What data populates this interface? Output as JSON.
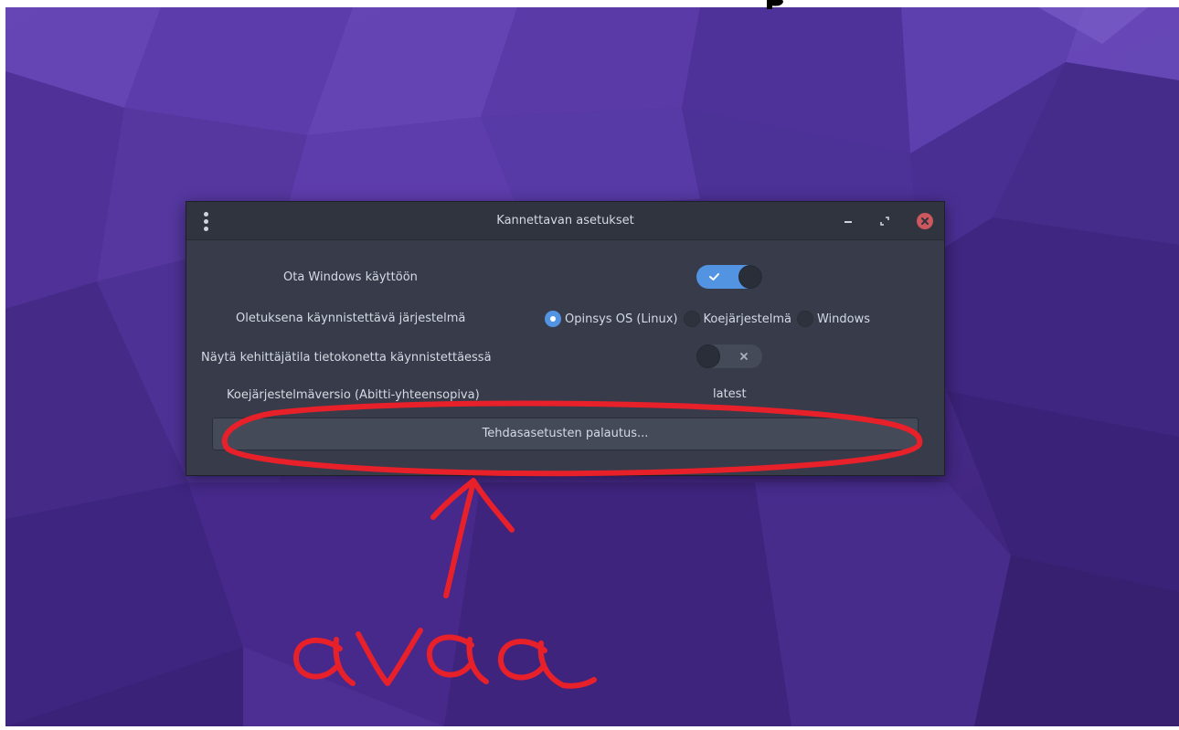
{
  "window": {
    "title": "Kannettavan asetukset"
  },
  "settings": {
    "enable_windows": {
      "label": "Ota Windows käyttöön",
      "state": "on"
    },
    "default_os": {
      "label": "Oletuksena käynnistettävä järjestelmä",
      "options": [
        {
          "label": "Opinsys OS (Linux)",
          "checked": true
        },
        {
          "label": "Koejärjestelmä",
          "checked": false
        },
        {
          "label": "Windows",
          "checked": false
        }
      ]
    },
    "developer_mode": {
      "label": "Näytä kehittäjätila tietokonetta käynnistettäessä",
      "state": "off"
    },
    "exam_version": {
      "label": "Koejärjestelmäversio (Abitti-yhteensopiva)",
      "value": "latest"
    },
    "factory_reset": {
      "label": "Tehdasasetusten palautus..."
    }
  },
  "annotation": {
    "text": "avaa",
    "color": "#e8202a"
  },
  "colors": {
    "accent": "#5294e2",
    "window_bg": "#383c4a",
    "titlebar_bg": "#2f343f",
    "text": "#d3dae3",
    "close": "#cc575d"
  },
  "icons": [
    "menu-dots-icon",
    "minimize-icon",
    "maximize-icon",
    "close-icon",
    "check-icon",
    "x-icon"
  ]
}
